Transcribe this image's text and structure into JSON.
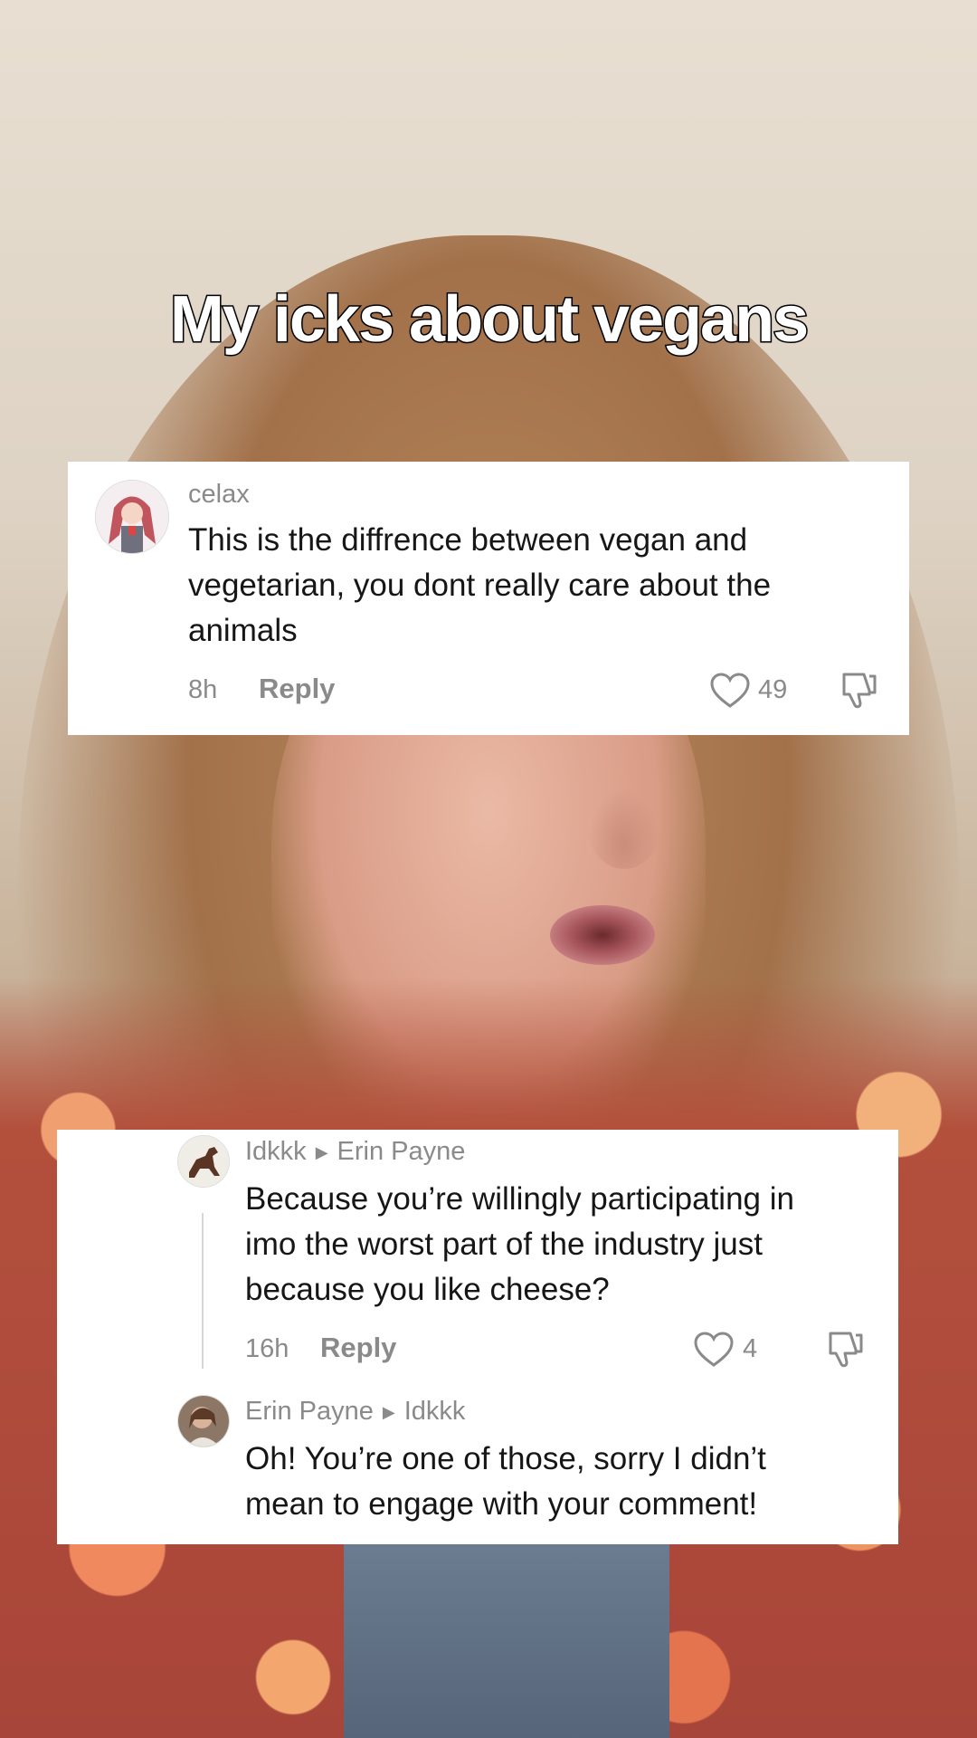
{
  "video": {
    "caption": "My icks about vegans"
  },
  "comment_main": {
    "username": "celax",
    "text_lines": [
      "This is the diffrence between vegan and",
      "vegetarian, you dont really care about the",
      "animals"
    ],
    "time": "8h",
    "reply_label": "Reply",
    "likes": "49",
    "avatar_icon": "anime-girl-avatar"
  },
  "reply_1": {
    "username": "Idkkk",
    "reply_to": "Erin Payne",
    "text_lines": [
      "Because you’re willingly participating in",
      "imo the worst part of the industry just",
      "because you like cheese?"
    ],
    "time": "16h",
    "reply_label": "Reply",
    "likes": "4",
    "avatar_icon": "horse-avatar"
  },
  "reply_2": {
    "username": "Erin Payne",
    "reply_to": "Idkkk",
    "text_lines": [
      "Oh! You’re one of those, sorry I didn’t",
      "mean to engage with your comment!"
    ],
    "avatar_icon": "person-avatar"
  },
  "colors": {
    "card_bg": "#ffffff",
    "muted_text": "#8a8a8a",
    "comment_text": "#161616"
  }
}
